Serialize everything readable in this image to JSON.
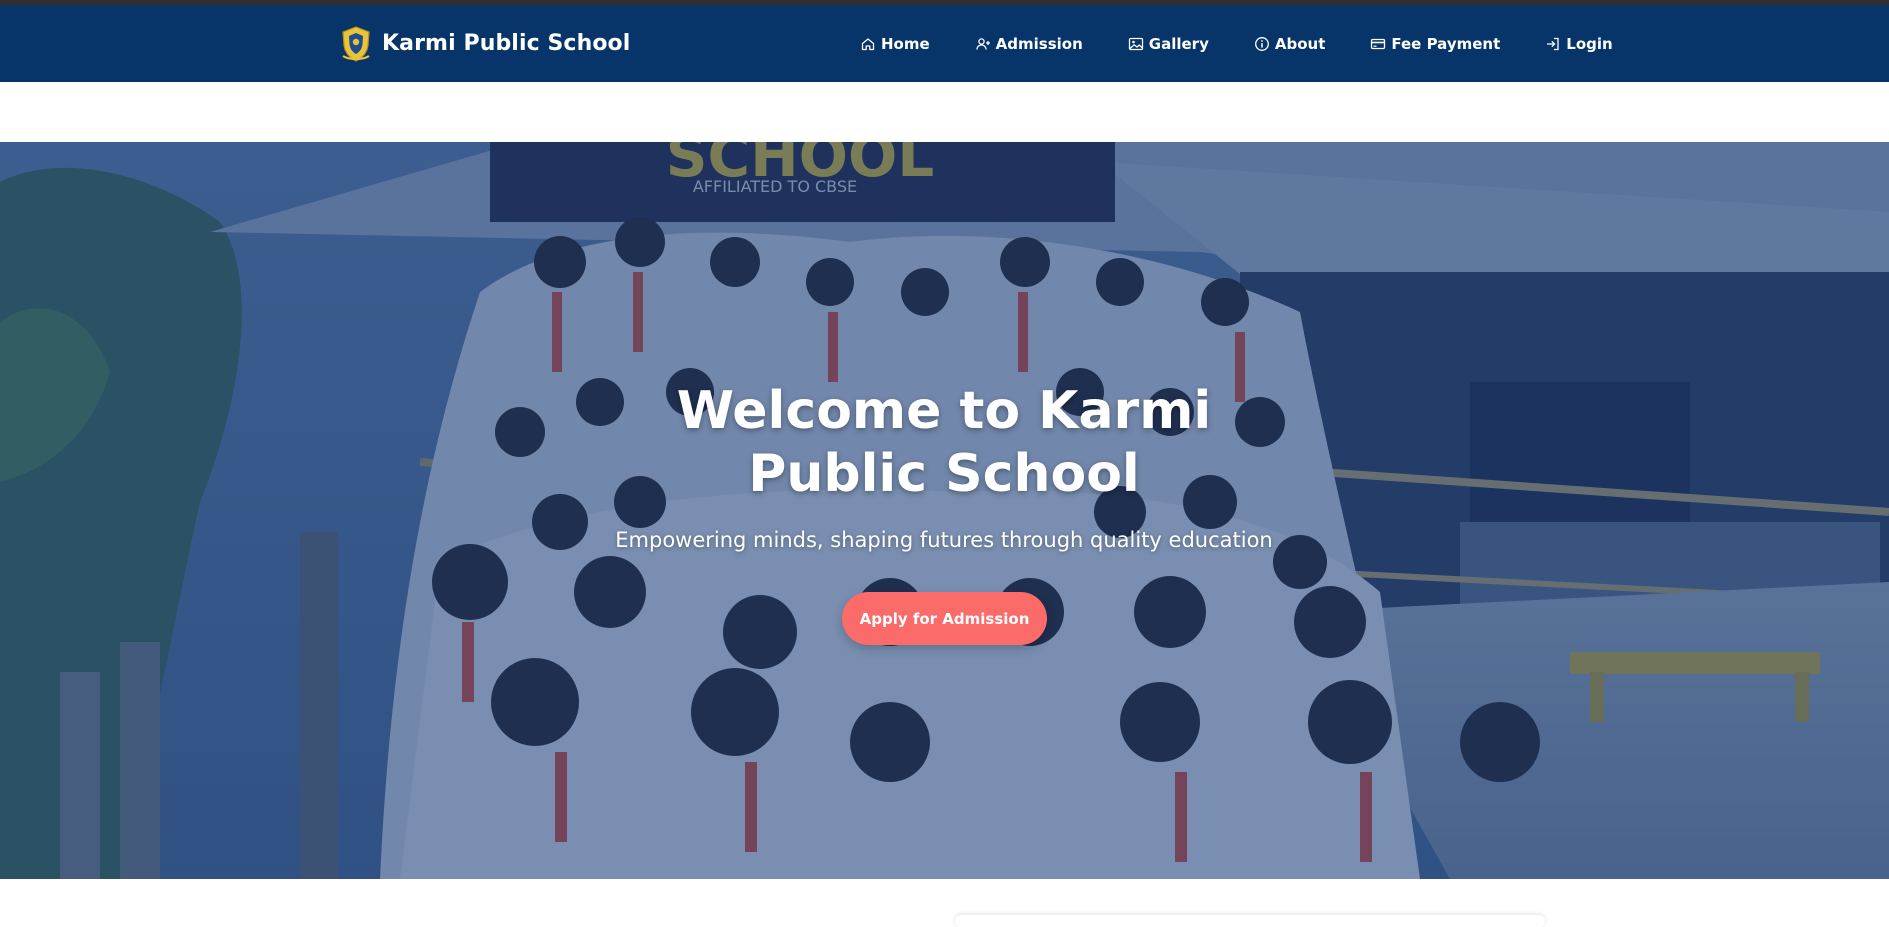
{
  "brand": {
    "name": "Karmi Public School",
    "logo_icon": "school-crest-icon"
  },
  "nav": {
    "items": [
      {
        "label": "Home",
        "icon": "home-icon"
      },
      {
        "label": "Admission",
        "icon": "user-plus-icon"
      },
      {
        "label": "Gallery",
        "icon": "image-icon"
      },
      {
        "label": "About",
        "icon": "info-icon"
      },
      {
        "label": "Fee Payment",
        "icon": "credit-card-icon"
      },
      {
        "label": "Login",
        "icon": "login-icon"
      }
    ]
  },
  "hero": {
    "title": "Welcome to Karmi Public School",
    "subtitle": "Empowering minds, shaping futures through quality education",
    "cta_label": "Apply for Admission",
    "photo_sign_text": "SCHOOL",
    "photo_sign_subtext": "AFFILIATED TO CBSE"
  },
  "colors": {
    "navbar": "#073569",
    "cta": "#fb6b69",
    "overlay": "#0e2f66",
    "text_on_dark": "#ffffff"
  }
}
